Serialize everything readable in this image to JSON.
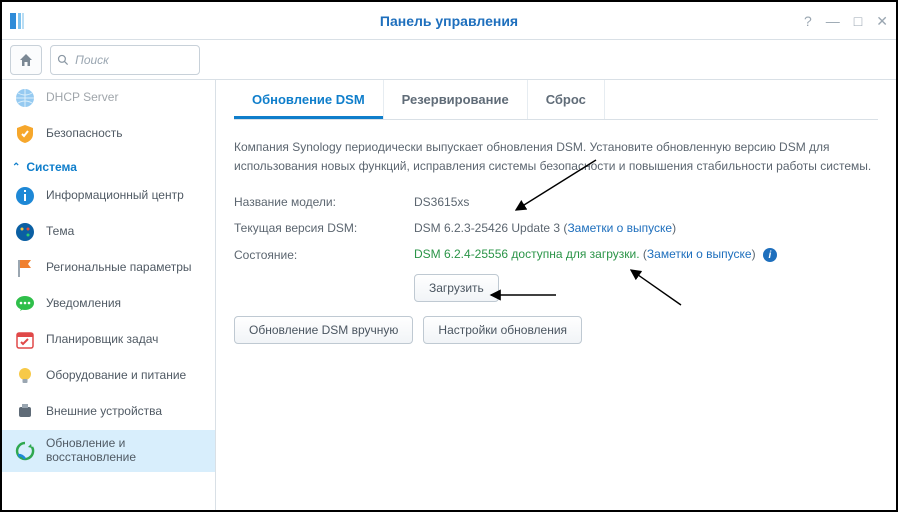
{
  "window": {
    "title": "Панель управления"
  },
  "search": {
    "placeholder": "Поиск"
  },
  "sidebar": {
    "top_item": "DHCP Server",
    "security": "Безопасность",
    "section_label": "Система",
    "items": [
      "Информационный центр",
      "Тема",
      "Региональные параметры",
      "Уведомления",
      "Планировщик задач",
      "Оборудование и питание",
      "Внешние устройства",
      "Обновление и восстановление"
    ]
  },
  "tabs": {
    "t1": "Обновление DSM",
    "t2": "Резервирование",
    "t3": "Сброс"
  },
  "content": {
    "desc": "Компания Synology периодически выпускает обновления DSM. Установите обновленную версию DSM для использования новых функций, исправления системы безопасности и повышения стабильности работы системы.",
    "row1_label": "Название модели:",
    "row1_value": "DS3615xs",
    "row2_label": "Текущая версия DSM:",
    "row2_value": "DSM 6.2.3-25426 Update 3",
    "row2_link": "Заметки о выпуске",
    "row3_label": "Состояние:",
    "row3_value": "DSM 6.2.4-25556 доступна для загрузки.",
    "row3_link": "Заметки о выпуске",
    "download_btn": "Загрузить",
    "manual_btn": "Обновление DSM вручную",
    "settings_btn": "Настройки обновления"
  }
}
